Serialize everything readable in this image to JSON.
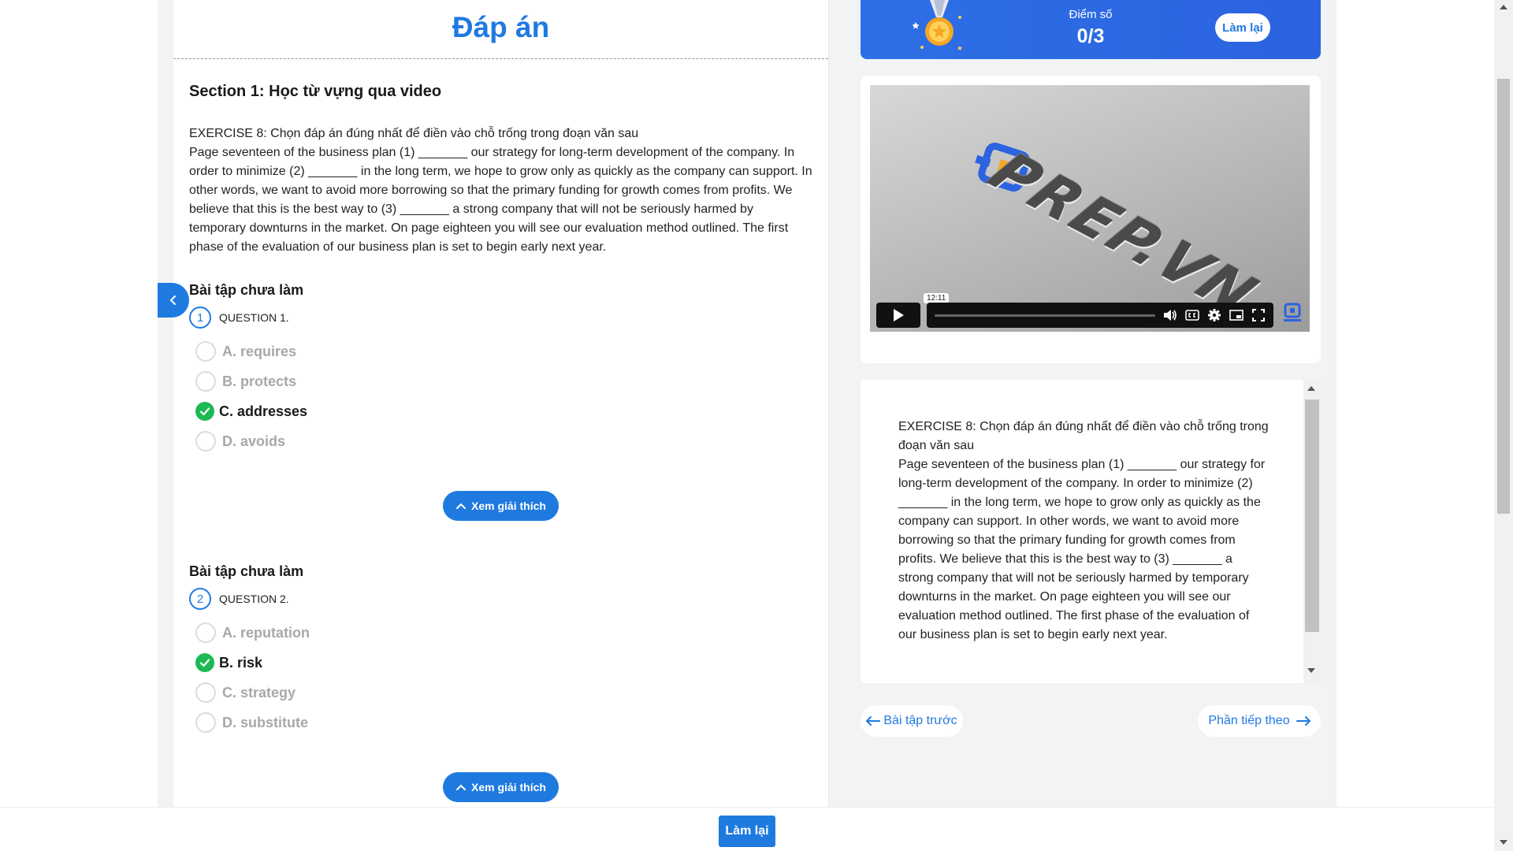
{
  "page": {
    "title": "Đáp án"
  },
  "section_title": "Section 1: Học từ vựng qua video",
  "exercise": {
    "heading": "EXERCISE 8: Chọn đáp án đúng nhất để điền vào chỗ trống trong đoạn văn sau",
    "passage": "Page seventeen of the business plan (1) _______ our strategy for long-term development of the company. In order to minimize (2) _______ in the long term, we hope to grow only as quickly as the company can support. In other words, we want to avoid more borrowing so that the primary funding for growth comes from profits. We believe that this is the best way to (3) _______ a strong company that will not be seriously harmed by temporary downturns in the market. On page eighteen you will see our evaluation method outlined. The first phase of the evaluation of our business plan is set to begin early next year."
  },
  "questions": [
    {
      "status": "Bài tập chưa làm",
      "number": "1",
      "label": "QUESTION 1.",
      "options": [
        "A. requires",
        "B. protects",
        "C. addresses",
        "D. avoids"
      ],
      "correct_index": 2,
      "explain_label": "Xem giải thích"
    },
    {
      "status": "Bài tập chưa làm",
      "number": "2",
      "label": "QUESTION 2.",
      "options": [
        "A. reputation",
        "B. risk",
        "C. strategy",
        "D. substitute"
      ],
      "correct_index": 1,
      "explain_label": "Xem giải thích"
    }
  ],
  "score": {
    "label": "Điểm số",
    "value": "0/3",
    "reset_label": "Làm lại"
  },
  "video": {
    "time_tooltip": "12:11",
    "brand": "PREP.VN",
    "progress": 0
  },
  "navigation": {
    "prev_label": "Bài tập trước",
    "next_label": "Phần tiếp theo"
  },
  "bottom": {
    "reset_label": "Làm lại"
  },
  "colors": {
    "accent": "#1f7ae0",
    "correct": "#1db954"
  }
}
